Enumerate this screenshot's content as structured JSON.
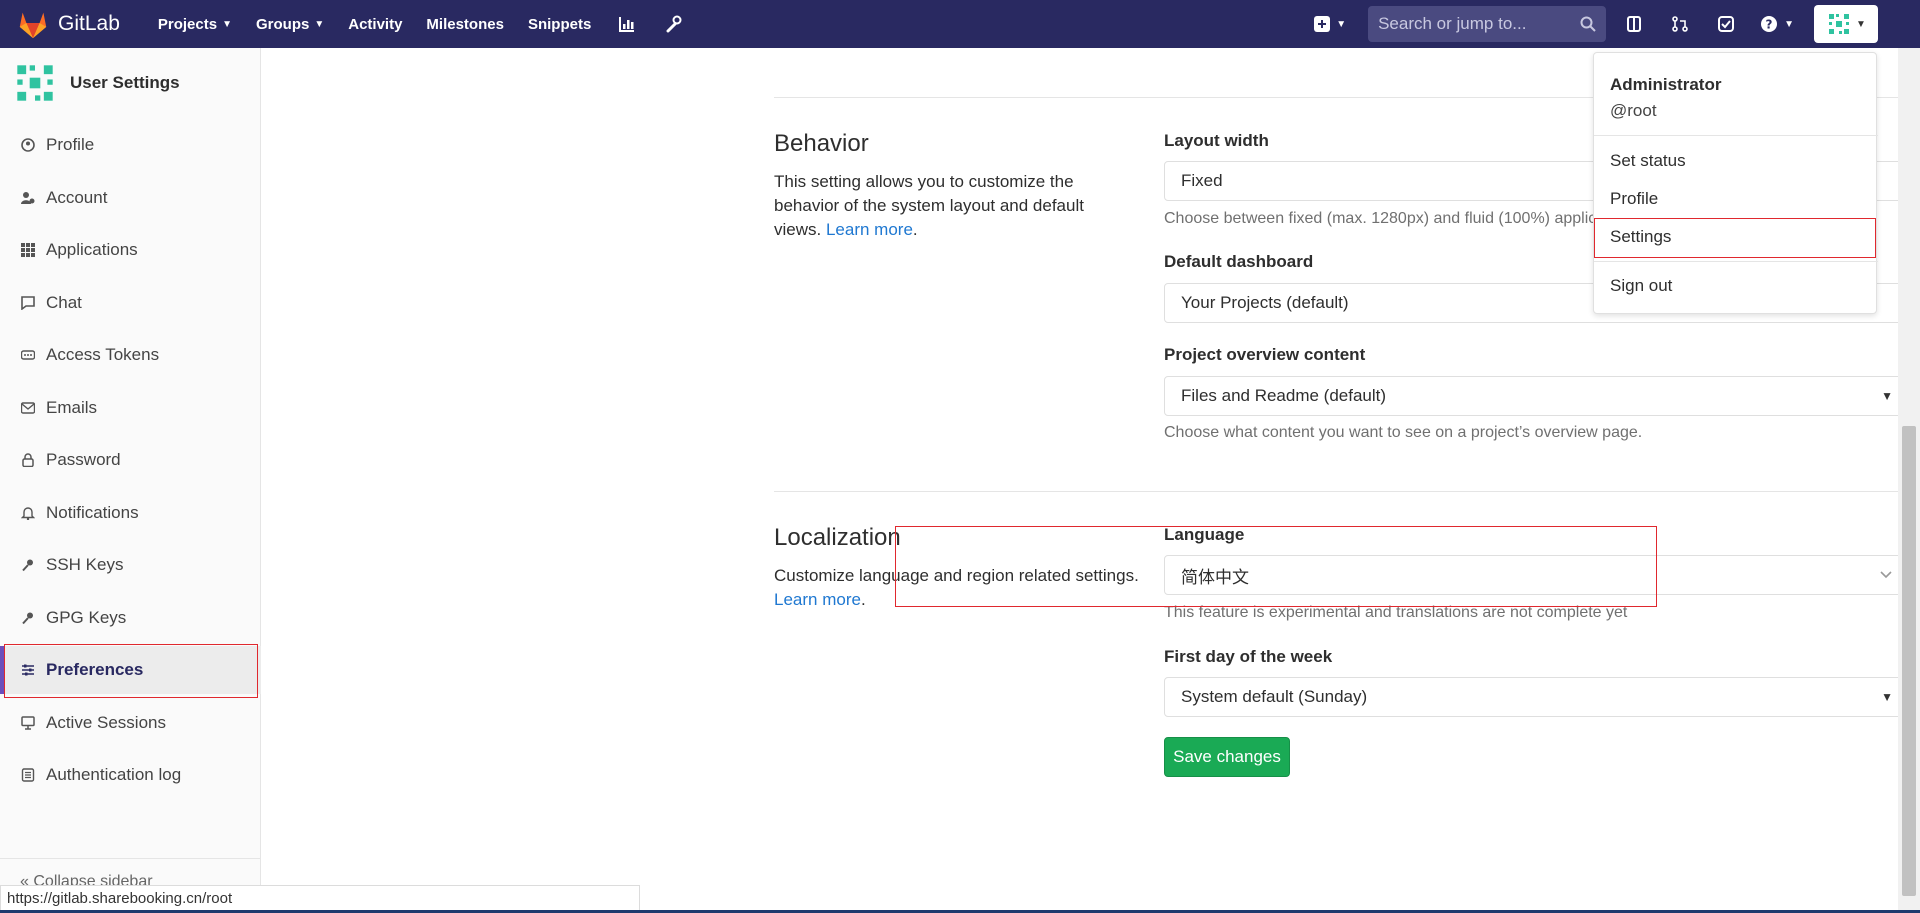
{
  "navbar": {
    "brand": "GitLab",
    "links": [
      {
        "label": "Projects",
        "has_caret": true
      },
      {
        "label": "Groups",
        "has_caret": true
      },
      {
        "label": "Activity",
        "has_caret": false
      },
      {
        "label": "Milestones",
        "has_caret": false
      },
      {
        "label": "Snippets",
        "has_caret": false
      }
    ],
    "search_placeholder": "Search or jump to...",
    "icons": [
      "chart-icon",
      "wrench-icon",
      "plus-square-icon",
      "search-icon",
      "issues-icon",
      "merge-request-icon",
      "todo-icon",
      "help-icon",
      "avatar-icon"
    ]
  },
  "sidebar": {
    "title": "User Settings",
    "items": [
      {
        "label": "Profile",
        "icon": "profile-icon"
      },
      {
        "label": "Account",
        "icon": "account-icon"
      },
      {
        "label": "Applications",
        "icon": "applications-icon"
      },
      {
        "label": "Chat",
        "icon": "chat-icon"
      },
      {
        "label": "Access Tokens",
        "icon": "token-icon"
      },
      {
        "label": "Emails",
        "icon": "email-icon"
      },
      {
        "label": "Password",
        "icon": "lock-icon"
      },
      {
        "label": "Notifications",
        "icon": "bell-icon"
      },
      {
        "label": "SSH Keys",
        "icon": "key-icon"
      },
      {
        "label": "GPG Keys",
        "icon": "key-icon"
      },
      {
        "label": "Preferences",
        "icon": "sliders-icon",
        "active": true
      },
      {
        "label": "Active Sessions",
        "icon": "monitor-icon"
      },
      {
        "label": "Authentication log",
        "icon": "log-icon"
      }
    ],
    "collapse_label": "Collapse sidebar"
  },
  "behavior": {
    "title": "Behavior",
    "desc": "This setting allows you to customize the behavior of the system layout and default views.",
    "learn_more": "Learn more",
    "layout_label": "Layout width",
    "layout_value": "Fixed",
    "layout_help": "Choose between fixed (max. 1280px) and fluid (100%) application layout.",
    "dashboard_label": "Default dashboard",
    "dashboard_value": "Your Projects (default)",
    "overview_label": "Project overview content",
    "overview_value": "Files and Readme (default)",
    "overview_help": "Choose what content you want to see on a project’s overview page."
  },
  "localization": {
    "title": "Localization",
    "desc": "Customize language and region related settings.",
    "learn_more": "Learn more",
    "language_label": "Language",
    "language_value": "简体中文",
    "language_help": "This feature is experimental and translations are not complete yet",
    "weekday_label": "First day of the week",
    "weekday_value": "System default (Sunday)"
  },
  "save_label": "Save changes",
  "dropdown": {
    "name": "Administrator",
    "username": "@root",
    "items": [
      "Set status",
      "Profile",
      "Settings",
      "Sign out"
    ]
  },
  "status_url": "https://gitlab.sharebooking.cn/root",
  "colors": {
    "navbar": "#292961",
    "accent": "#6b4fbb",
    "save": "#1aaa55",
    "highlight": "#e0282e"
  }
}
